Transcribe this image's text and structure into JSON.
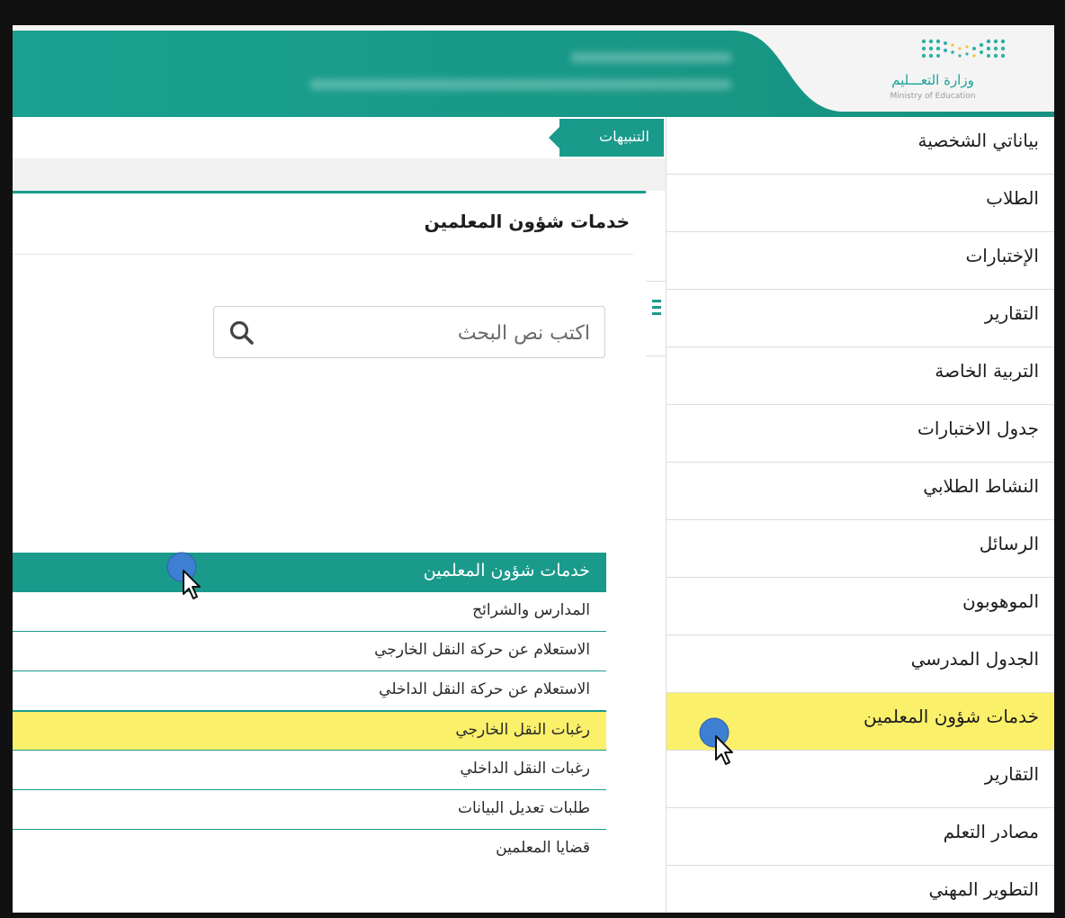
{
  "header": {
    "logo_title": "وزارة التعـــليم",
    "logo_subtitle": "Ministry of Education"
  },
  "notifications": {
    "label": "التنبيهات"
  },
  "sidebar": {
    "items": [
      {
        "label": "بياناتي الشخصية"
      },
      {
        "label": "الطلاب"
      },
      {
        "label": "الإختبارات"
      },
      {
        "label": "التقارير"
      },
      {
        "label": "التربية الخاصة"
      },
      {
        "label": "جدول الاختبارات"
      },
      {
        "label": "النشاط الطلابي"
      },
      {
        "label": "الرسائل"
      },
      {
        "label": "الموهوبون"
      },
      {
        "label": "الجدول المدرسي"
      },
      {
        "label": "خدمات شؤون المعلمين",
        "active": true
      },
      {
        "label": "التقارير"
      },
      {
        "label": "مصادر التعلم"
      },
      {
        "label": "التطوير المهني"
      }
    ]
  },
  "main": {
    "title": "خدمات شؤون المعلمين",
    "search": {
      "placeholder": "اكتب نص البحث",
      "value": ""
    },
    "services": {
      "header": "خدمات شؤون المعلمين",
      "items": [
        {
          "label": "المدارس والشرائح"
        },
        {
          "label": "الاستعلام عن حركة النقل الخارجي"
        },
        {
          "label": "الاستعلام عن حركة النقل الداخلي"
        },
        {
          "label": "رغبات النقل الخارجي",
          "active": true
        },
        {
          "label": "رغبات النقل الداخلي"
        },
        {
          "label": "طلبات تعديل البيانات"
        },
        {
          "label": "قضايا المعلمين"
        }
      ]
    }
  },
  "colors": {
    "accent": "#1a9a8b",
    "highlight": "#fbf06a",
    "cursor_dot": "#3d7fd0"
  },
  "icons": [
    "search-icon",
    "menu-bars-icon",
    "cursor-pointer-icon"
  ]
}
